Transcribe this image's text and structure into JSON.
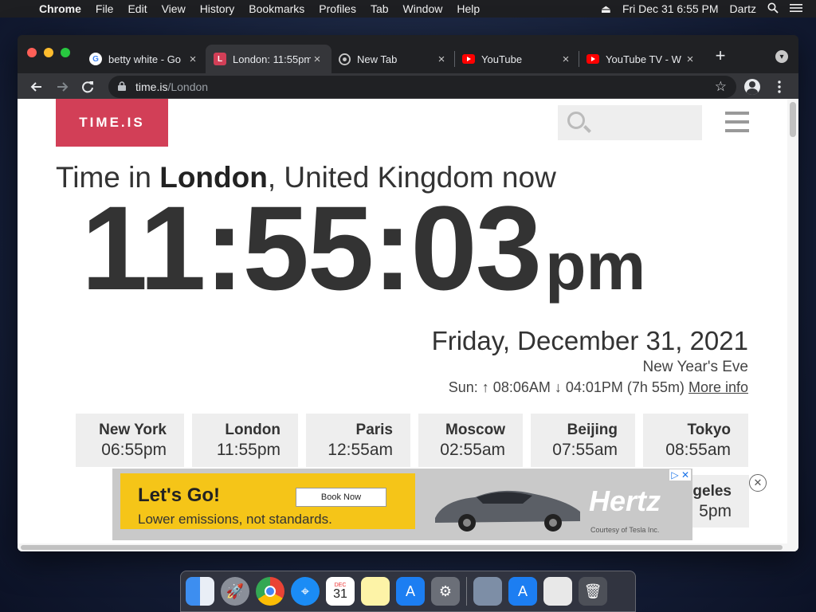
{
  "menubar": {
    "apple_icon": "apple-icon",
    "app_name": "Chrome",
    "menus": [
      "File",
      "Edit",
      "View",
      "History",
      "Bookmarks",
      "Profiles",
      "Tab",
      "Window",
      "Help"
    ],
    "clock": "Fri Dec 31  6:55 PM",
    "user": "Dartz"
  },
  "browser": {
    "tabs": [
      {
        "title": "betty white - Go",
        "favicon": "google-icon"
      },
      {
        "title": "London: 11:55pm",
        "favicon": "timeis-icon",
        "favicon_text": "L"
      },
      {
        "title": "New Tab",
        "favicon": "chrome-icon"
      },
      {
        "title": "YouTube",
        "favicon": "youtube-icon"
      },
      {
        "title": "YouTube TV - W",
        "favicon": "youtube-icon"
      }
    ],
    "url_host": "time.is",
    "url_path": "/London"
  },
  "page": {
    "logo": "TIME.IS",
    "headline_prefix": "Time in ",
    "headline_city": "London",
    "headline_suffix": ", United Kingdom now",
    "clock": "11:55:03",
    "ampm": "pm",
    "date": "Friday, December 31, 2021",
    "holiday": "New Year's Eve",
    "sun_text": "Sun: ↑ 08:06AM ↓ 04:01PM (7h 55m)",
    "more_info": "More info",
    "cities": [
      {
        "name": "New York",
        "time": "06:55pm"
      },
      {
        "name": "London",
        "time": "11:55pm"
      },
      {
        "name": "Paris",
        "time": "12:55am"
      },
      {
        "name": "Moscow",
        "time": "02:55am"
      },
      {
        "name": "Beijing",
        "time": "07:55am"
      },
      {
        "name": "Tokyo",
        "time": "08:55am"
      }
    ],
    "partial_city": {
      "name": "geles",
      "time": "5pm"
    }
  },
  "ad": {
    "title": "Let's Go!",
    "subtitle": "Lower emissions, not standards.",
    "cta": "Book Now",
    "brand": "Hertz",
    "courtesy": "Courtesy of Tesla Inc.",
    "close": "✕"
  },
  "colors": {
    "brand": "#d23f57",
    "ad_yellow": "#f5c518"
  }
}
